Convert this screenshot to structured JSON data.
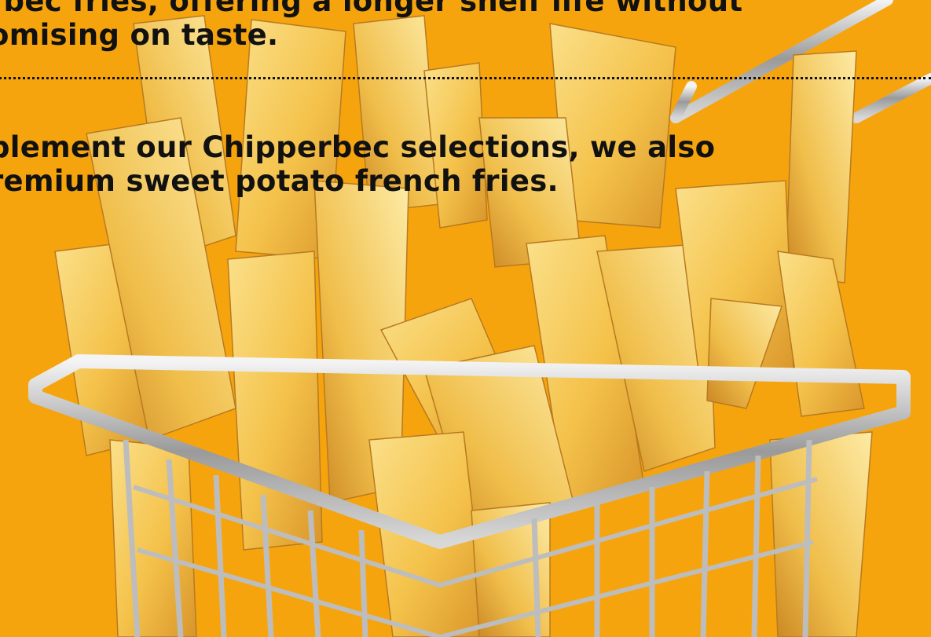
{
  "colors": {
    "background": "#F6A40E",
    "text": "#111111"
  },
  "image": {
    "subject": "french-fries-in-wire-basket"
  },
  "content": {
    "paragraph_one": {
      "line_1": "rbec fries, offering a longer shelf life without",
      "line_2": "omising on taste."
    },
    "paragraph_two": {
      "line_1": "plement our Chipperbec selections, we also",
      "line_2": "remium sweet potato french fries."
    }
  }
}
